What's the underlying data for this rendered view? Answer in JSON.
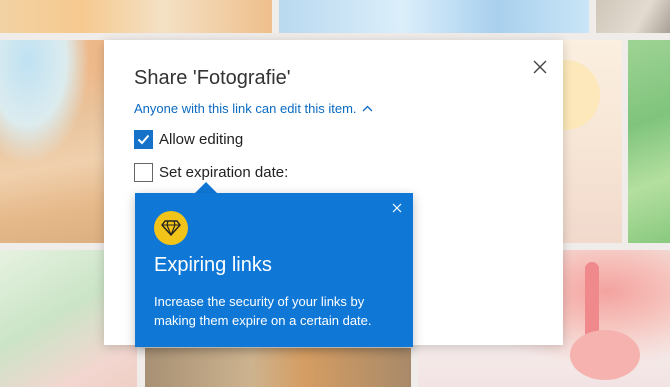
{
  "dialog": {
    "title": "Share 'Fotografie'",
    "permission_link": "Anyone with this link can edit this item.",
    "options": [
      {
        "label": "Allow editing",
        "checked": true
      },
      {
        "label": "Set expiration date:",
        "checked": false
      }
    ]
  },
  "callout": {
    "icon": "diamond-icon",
    "title": "Expiring links",
    "body": "Increase the security of your links by making them expire on a certain date."
  },
  "colors": {
    "accent": "#0f78d7",
    "link": "#0a6ac2",
    "checkbox_on": "#1672c9",
    "badge": "#f2c318"
  }
}
